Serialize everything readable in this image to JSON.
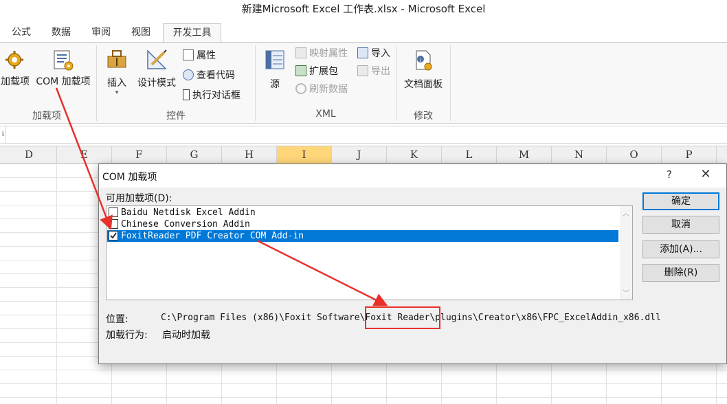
{
  "window": {
    "title": "新建Microsoft Excel 工作表.xlsx - Microsoft Excel"
  },
  "tabs": [
    "公式",
    "数据",
    "审阅",
    "视图",
    "开发工具"
  ],
  "ribbon": {
    "addins_group": {
      "addins_label": "加载项",
      "com_addins_label": "COM 加载项",
      "group_label": "加载项"
    },
    "controls_group": {
      "insert_label": "插入",
      "design_mode_label": "设计模式",
      "properties_label": "属性",
      "view_code_label": "查看代码",
      "run_dialog_label": "执行对话框",
      "group_label": "控件"
    },
    "xml_group": {
      "source_label": "源",
      "map_properties_label": "映射属性",
      "expansion_packs_label": "扩展包",
      "refresh_data_label": "刷新数据",
      "import_label": "导入",
      "export_label": "导出",
      "group_label": "XML"
    },
    "modify_group": {
      "doc_panel_label": "文档面板",
      "group_label": "修改"
    }
  },
  "grid": {
    "columns": [
      "D",
      "E",
      "F",
      "G",
      "H",
      "I",
      "J",
      "K",
      "L",
      "M",
      "N",
      "O",
      "P"
    ],
    "selected_column": "I"
  },
  "dialog": {
    "title": "COM 加载项",
    "help": "?",
    "close": "✕",
    "available_label": "可用加载项(D):",
    "addins": [
      {
        "name": "Baidu Netdisk Excel Addin",
        "checked": false
      },
      {
        "name": "Chinese Conversion Addin",
        "checked": false
      },
      {
        "name": "FoxitReader PDF Creator COM Add-in",
        "checked": true
      }
    ],
    "buttons": {
      "ok": "确定",
      "cancel": "取消",
      "add": "添加(A)...",
      "remove": "删除(R)"
    },
    "location_label": "位置:",
    "location_prefix": "C:\\Program Files (x86)\\Foxit Software\\",
    "location_highlight": "Foxit Reader",
    "location_suffix": "\\plugins\\Creator\\x86\\FPC_ExcelAddin_x86.dll",
    "load_behavior_label": "加载行为:",
    "load_behavior_value": "启动时加载"
  },
  "annotations": {
    "color": "#e8302a"
  }
}
